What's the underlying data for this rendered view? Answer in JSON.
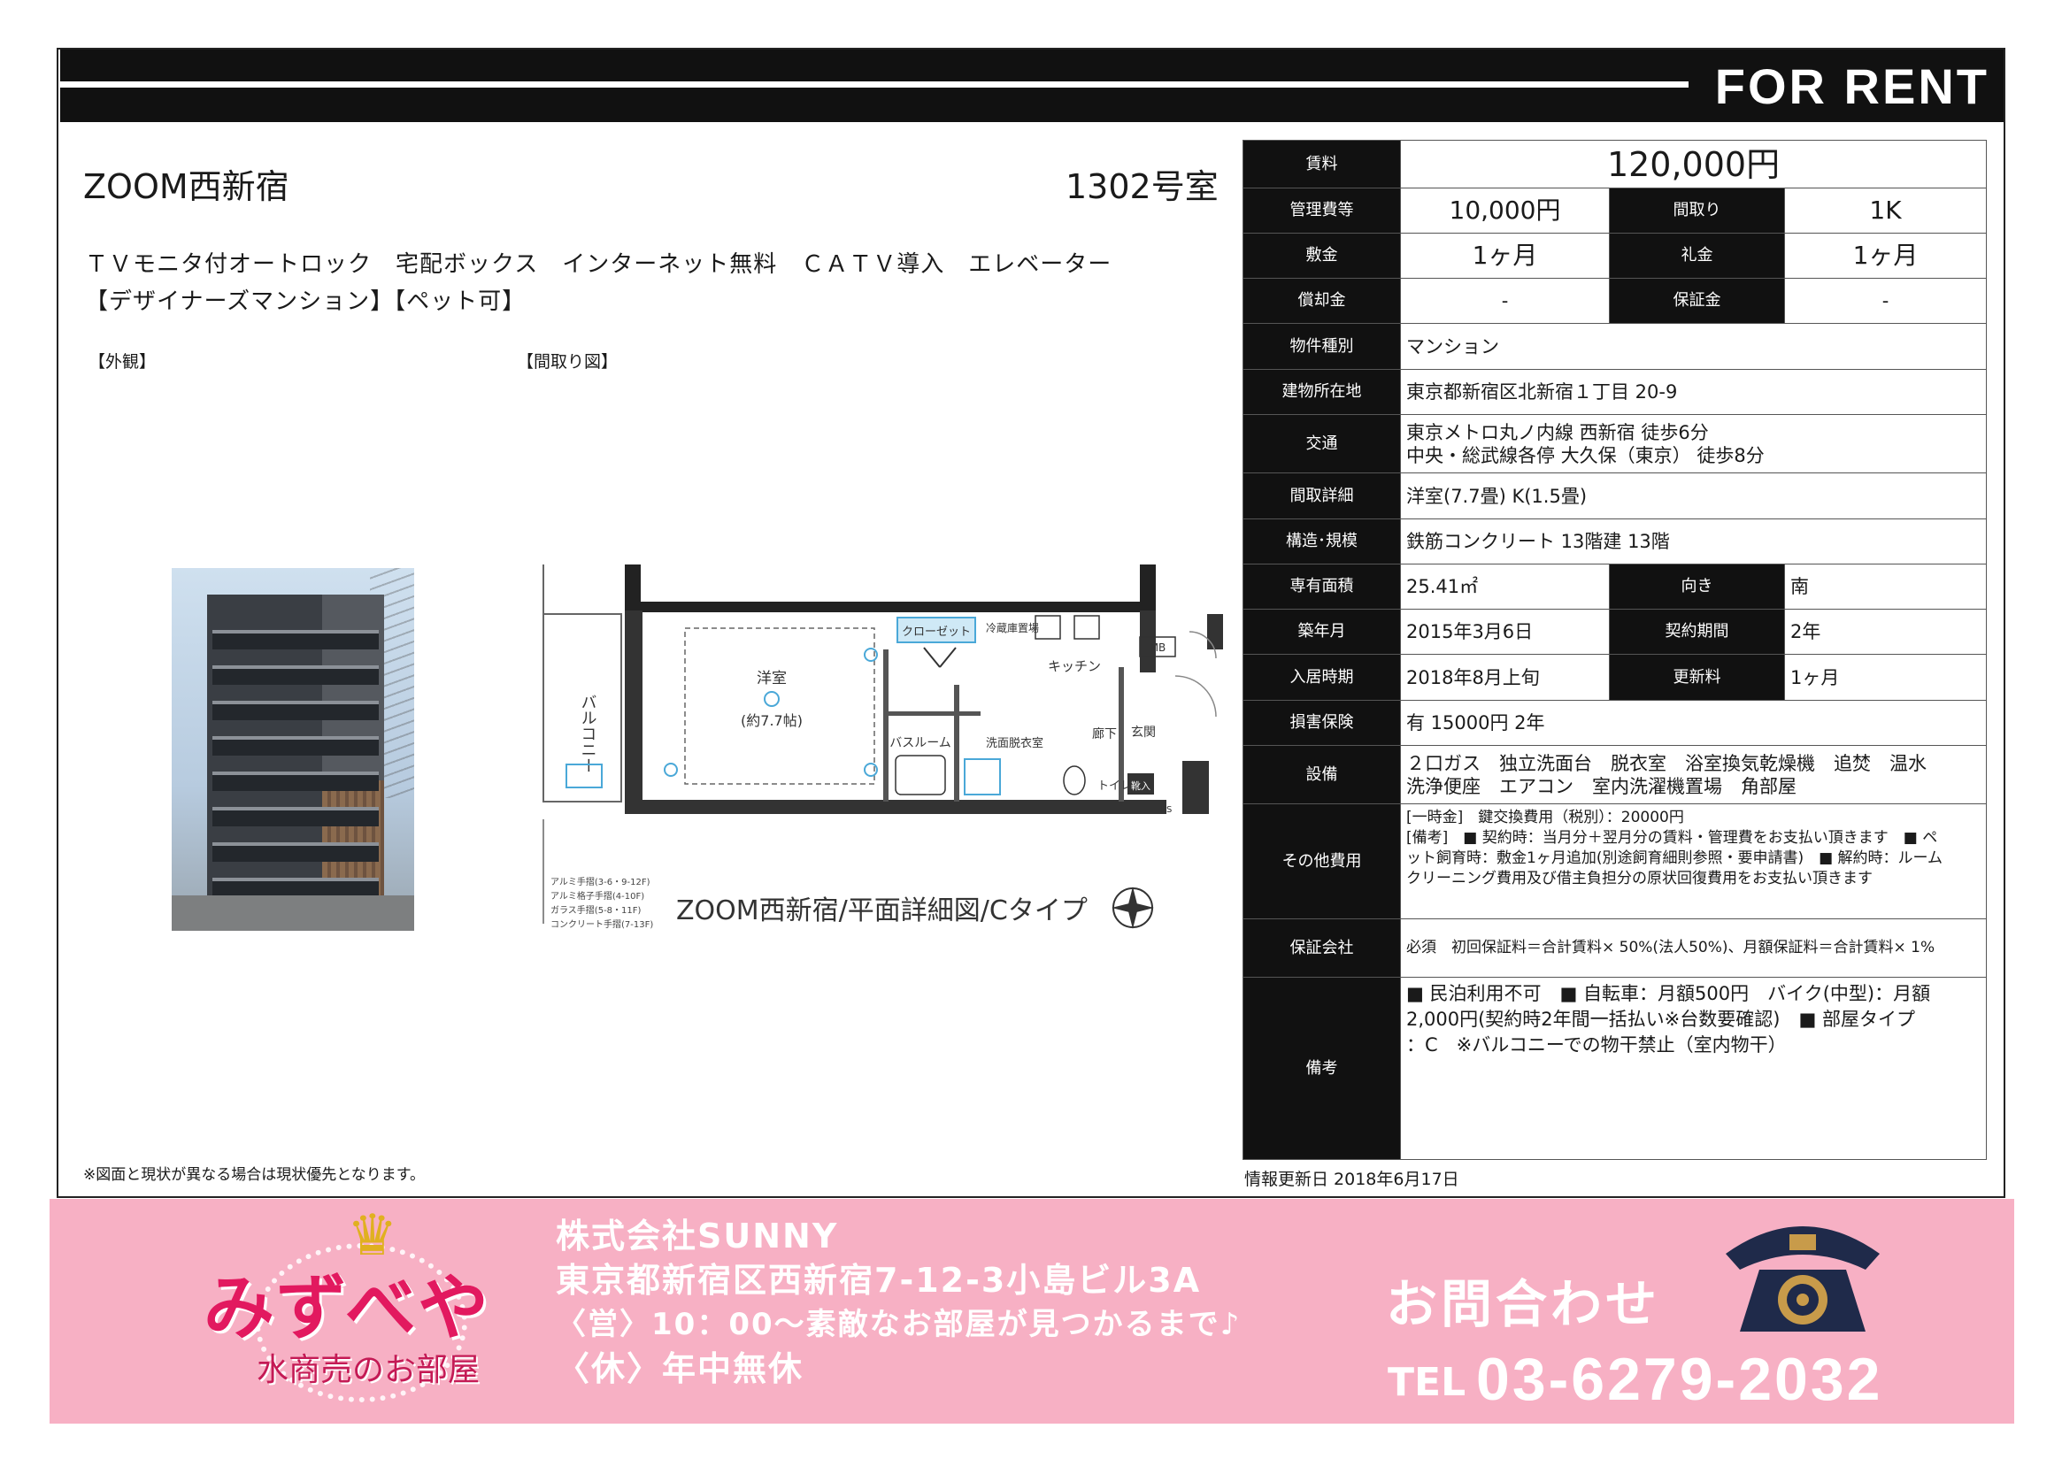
{
  "header": {
    "for_rent": "FOR RENT"
  },
  "property": {
    "name": "ZOOM西新宿",
    "room": "1302号室",
    "features_line1": "ＴＶモニタ付オートロック　宅配ボックス　インターネット無料　ＣＡＴＶ導入　エレベーター",
    "features_line2": "【デザイナーズマンション】【ペット可】",
    "exterior_label": "【外観】",
    "floorplan_label": "【間取り図】",
    "floorplan_caption": "ZOOM西新宿/平面詳細図/Cタイプ",
    "note": "※図面と現状が異なる場合は現状優先となります。"
  },
  "details": {
    "rent_label": "賃料",
    "rent": "120,000円",
    "mgmt_label": "管理費等",
    "mgmt": "10,000円",
    "layout_label": "間取り",
    "layout": "1K",
    "deposit_label": "敷金",
    "deposit": "1ヶ月",
    "keymoney_label": "礼金",
    "keymoney": "1ヶ月",
    "amort_label": "償却金",
    "amort": "-",
    "guarantee_label": "保証金",
    "guarantee": "-",
    "type_label": "物件種別",
    "type": "マンション",
    "address_label": "建物所在地",
    "address": "東京都新宿区北新宿１丁目 20-9",
    "transport_label": "交通",
    "transport1": "東京メトロ丸ノ内線 西新宿 徒歩6分",
    "transport2": "中央・総武線各停 大久保（東京） 徒歩8分",
    "rooms_label": "間取詳細",
    "rooms": "洋室(7.7畳) K(1.5畳)",
    "structure_label": "構造･規模",
    "structure": "鉄筋コンクリート 13階建 13階",
    "area_label": "専有面積",
    "area": "25.41㎡",
    "direction_label": "向き",
    "direction": "南",
    "built_label": "築年月",
    "built": "2015年3月6日",
    "contract_label": "契約期間",
    "contract": "2年",
    "movein_label": "入居時期",
    "movein": "2018年8月上旬",
    "renewal_label": "更新料",
    "renewal": "1ヶ月",
    "insurance_label": "損害保険",
    "insurance": "有  15000円 2年",
    "equip_label": "設備",
    "equip1": "２口ガス　独立洗面台　脱衣室　浴室換気乾燥機　追焚　温水",
    "equip2": "洗浄便座　エアコン　室内洗濯機置場　角部屋",
    "other_label": "その他費用",
    "other1": "[一時金]　鍵交換費用（税別）：20000円",
    "other2": "[備考]　■ 契約時：当月分＋翌月分の賃料・管理費をお支払い頂きます　■ ペ",
    "other3": "ット飼育時：敷金1ヶ月追加(別途飼育細則参照・要申請書)　■ 解約時：ルーム",
    "other4": "クリーニング費用及び借主負担分の原状回復費用をお支払い頂きます",
    "gcompany_label": "保証会社",
    "gcompany": "必須　初回保証料＝合計賃料× 50%(法人50%)、月額保証料＝合計賃料× 1%",
    "remarks_label": "備考",
    "remarks1": "■ 民泊利用不可　■ 自転車：月額500円　バイク(中型)：月額",
    "remarks2": "2,000円(契約時2年間一括払い※台数要確認)　■ 部屋タイプ",
    "remarks3": "：C　※バルコニーでの物干禁止（室内物干）",
    "updated": "情報更新日 2018年6月17日"
  },
  "floorplan_labels": {
    "balcony": "バルコニー",
    "western": "洋室",
    "western_size": "(約7.7帖)",
    "closet": "クローゼット",
    "fridge": "冷蔵庫置場",
    "kitchen": "キッチン",
    "corridor": "廊下",
    "entrance": "玄関",
    "bath": "バスルーム",
    "washroom": "洗面脱衣室",
    "toilet": "トイレ",
    "shoe": "靴入",
    "mb": "MB",
    "ps": "PS",
    "rail1": "アルミ手摺(3-6・9-12F)",
    "rail2": "アルミ格子手摺(4-10F)",
    "rail3": "ガラス手摺(5-8・11F)",
    "rail4": "コンクリート手摺(7-13F)"
  },
  "footer": {
    "logo": "みずべや",
    "logo_sub": "水商売のお部屋",
    "company": "株式会社SUNNY",
    "address": "東京都新宿区西新宿7-12-3小島ビル3A",
    "hours": "〈営〉10：00〜素敵なお部屋が見つかるまで♪",
    "holiday": "〈休〉年中無休",
    "contact_label": "お問合わせ",
    "tel_prefix": "TEL",
    "tel": "03-6279-2032"
  },
  "colors": {
    "header": "#111111",
    "footer_pink": "#f7b0c4",
    "logo_pink": "#e2195f",
    "fixture_blue": "#4aa8d8"
  }
}
